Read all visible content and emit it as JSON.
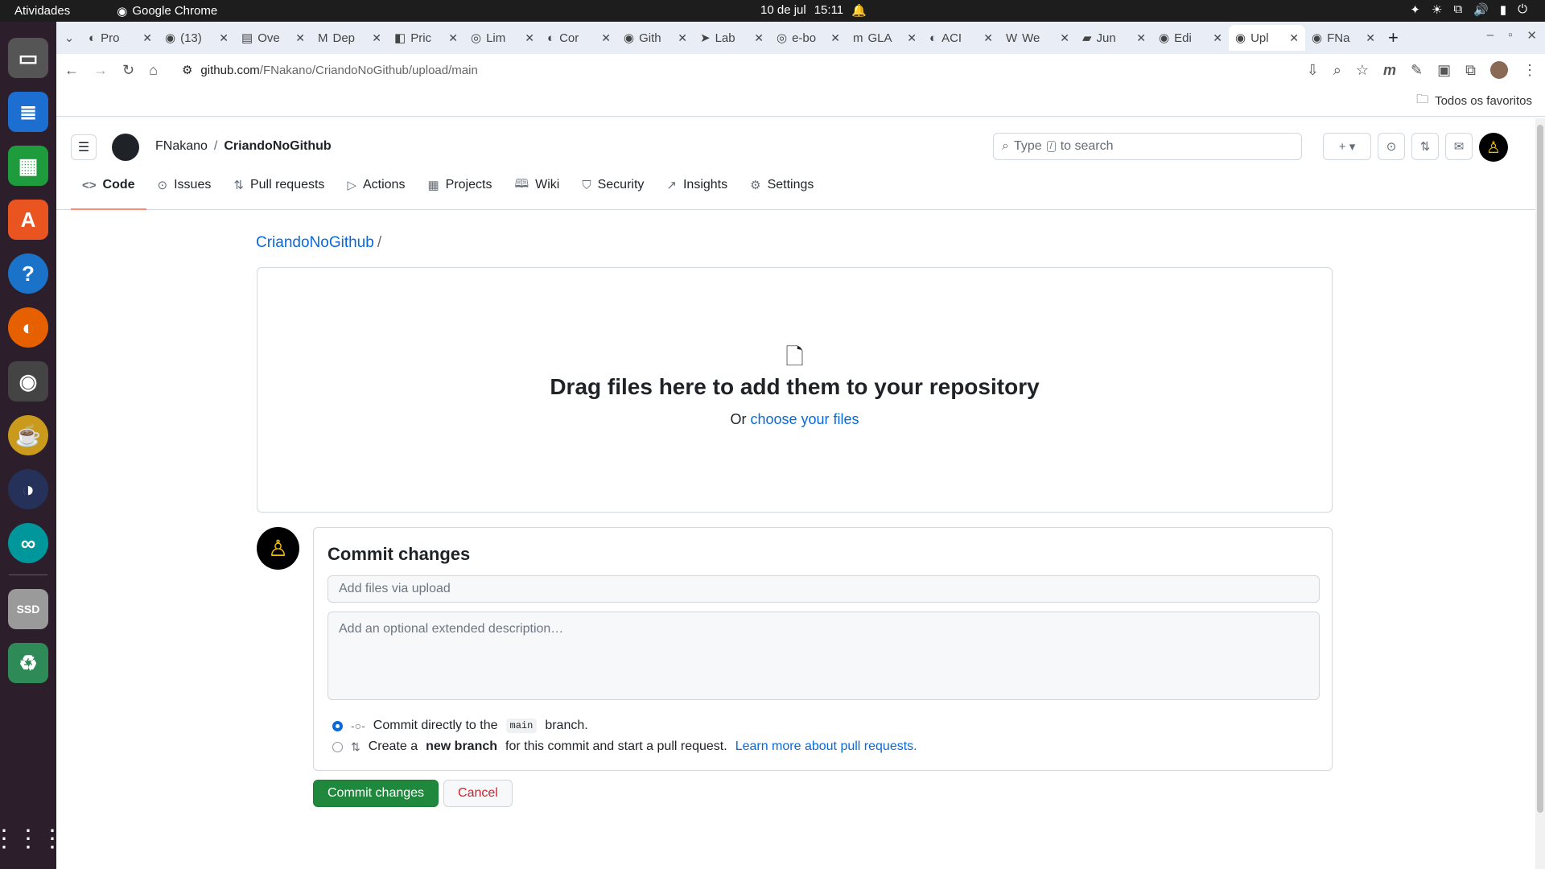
{
  "system": {
    "activities": "Atividades",
    "app_name": "Google Chrome",
    "date": "10 de jul",
    "time": "15:11"
  },
  "browser": {
    "tabs": [
      {
        "label": "Pro"
      },
      {
        "label": "(13)"
      },
      {
        "label": "Ove"
      },
      {
        "label": "Dep"
      },
      {
        "label": "Pric"
      },
      {
        "label": "Lim"
      },
      {
        "label": "Cor"
      },
      {
        "label": "Gith"
      },
      {
        "label": "Lab"
      },
      {
        "label": "e-bo"
      },
      {
        "label": "GLA"
      },
      {
        "label": "ACI"
      },
      {
        "label": "We"
      },
      {
        "label": "Jun"
      },
      {
        "label": "Edi"
      },
      {
        "label": "Upl"
      },
      {
        "label": "FNa"
      }
    ],
    "active_tab_index": 15,
    "url_domain": "github.com",
    "url_path": "/FNakano/CriandoNoGithub/upload/main",
    "bookmarks_label": "Todos os favoritos"
  },
  "github": {
    "owner": "FNakano",
    "repo": "CriandoNoGithub",
    "search_placeholder_before": "Type",
    "search_key": "/",
    "search_placeholder_after": "to search",
    "repo_tabs": [
      {
        "label": "Code",
        "icon": "code-icon"
      },
      {
        "label": "Issues",
        "icon": "issue-icon"
      },
      {
        "label": "Pull requests",
        "icon": "pull-request-icon"
      },
      {
        "label": "Actions",
        "icon": "play-icon"
      },
      {
        "label": "Projects",
        "icon": "table-icon"
      },
      {
        "label": "Wiki",
        "icon": "book-icon"
      },
      {
        "label": "Security",
        "icon": "shield-icon"
      },
      {
        "label": "Insights",
        "icon": "graph-icon"
      },
      {
        "label": "Settings",
        "icon": "gear-icon"
      }
    ],
    "selected_tab": "Code"
  },
  "upload": {
    "breadcrumb_repo": "CriandoNoGithub",
    "breadcrumb_sep": "/",
    "drop_title": "Drag files here to add them to your repository",
    "drop_or": "Or",
    "choose_files": "choose your files"
  },
  "commit": {
    "title": "Commit changes",
    "message_placeholder": "Add files via upload",
    "description_placeholder": "Add an optional extended description…",
    "option_direct_prefix": "Commit directly to the",
    "branch_name": "main",
    "option_direct_suffix": "branch.",
    "option_new_prefix": "Create a",
    "option_new_bold": "new branch",
    "option_new_suffix": "for this commit and start a pull request.",
    "learn_more": "Learn more about pull requests.",
    "commit_button": "Commit changes",
    "cancel_button": "Cancel"
  },
  "colors": {
    "accent_blue": "#0969da",
    "commit_green": "#1f883d",
    "cancel_red": "#cf222e"
  }
}
